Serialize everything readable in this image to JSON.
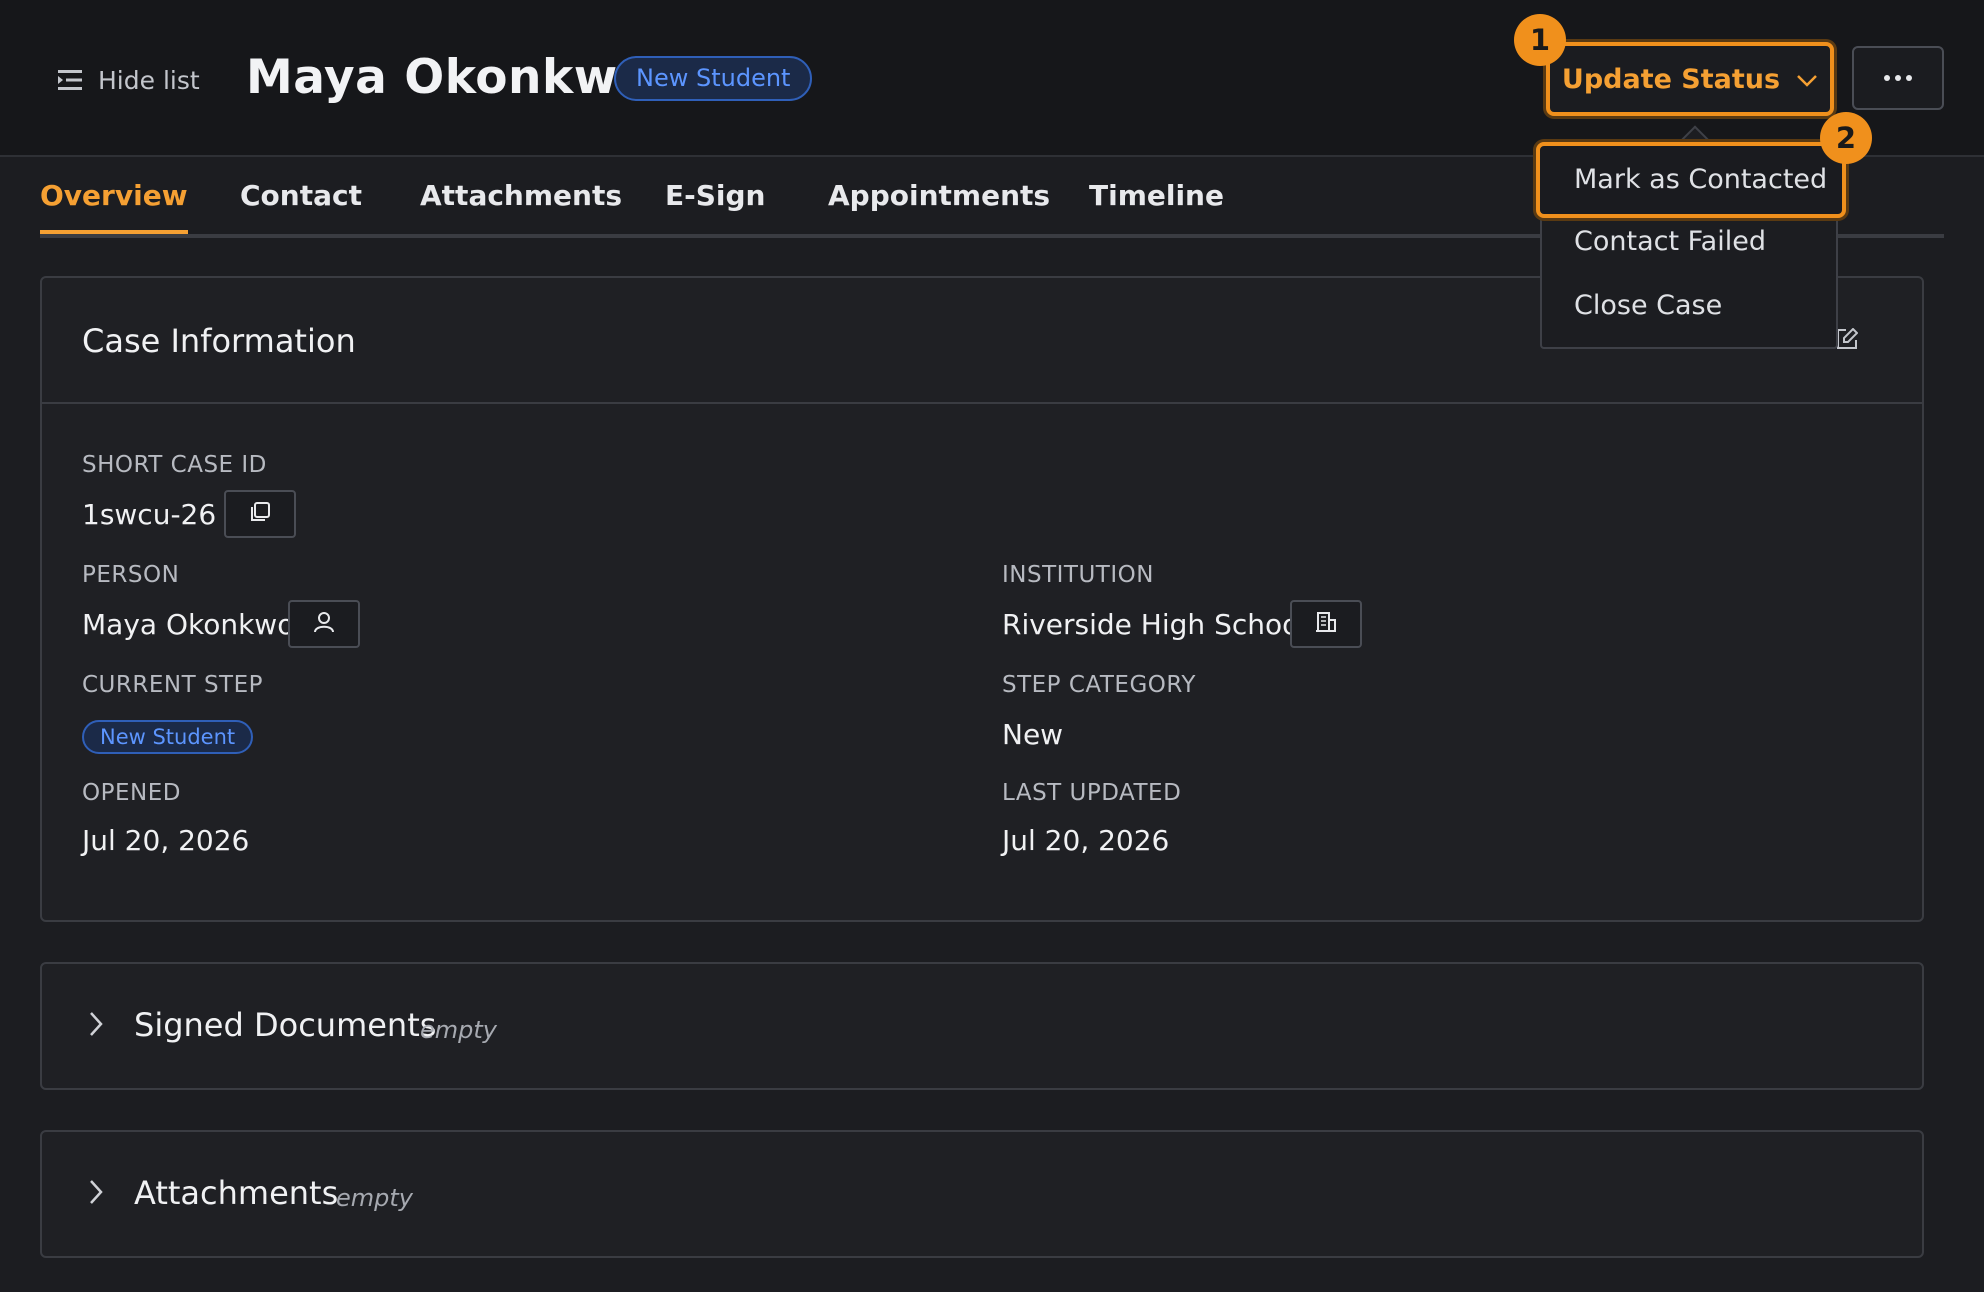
{
  "header": {
    "hide_list_label": "Hide list",
    "title": "Maya Okonkwo",
    "step_badge": "New Student",
    "update_status_label": "Update Status"
  },
  "markers": {
    "first": "1",
    "second": "2"
  },
  "dropdown": {
    "items": [
      "Mark as Contacted",
      "Contact Failed",
      "Close Case"
    ]
  },
  "tabs": [
    "Overview",
    "Contact",
    "Attachments",
    "E-Sign",
    "Appointments",
    "Timeline"
  ],
  "case_info": {
    "title": "Case Information",
    "short_case_id_label": "SHORT CASE ID",
    "short_case_id": "1swcu-26",
    "person_label": "PERSON",
    "person": "Maya Okonkwo",
    "institution_label": "INSTITUTION",
    "institution": "Riverside High School",
    "current_step_label": "CURRENT STEP",
    "current_step": "New Student",
    "step_category_label": "STEP CATEGORY",
    "step_category": "New",
    "opened_label": "OPENED",
    "opened": "Jul 20, 2026",
    "last_updated_label": "LAST UPDATED",
    "last_updated": "Jul 20, 2026"
  },
  "sections": [
    {
      "title": "Signed Documents",
      "state": "empty"
    },
    {
      "title": "Attachments",
      "state": "empty"
    }
  ],
  "colors": {
    "accent": "#f0901c",
    "badge_blue": "#5c95ff",
    "background": "#1c1d21"
  },
  "icons": [
    "list-collapse-icon",
    "chevron-down-icon",
    "more-icon",
    "copy-icon",
    "person-icon",
    "building-icon",
    "edit-icon",
    "chevron-right-icon"
  ]
}
